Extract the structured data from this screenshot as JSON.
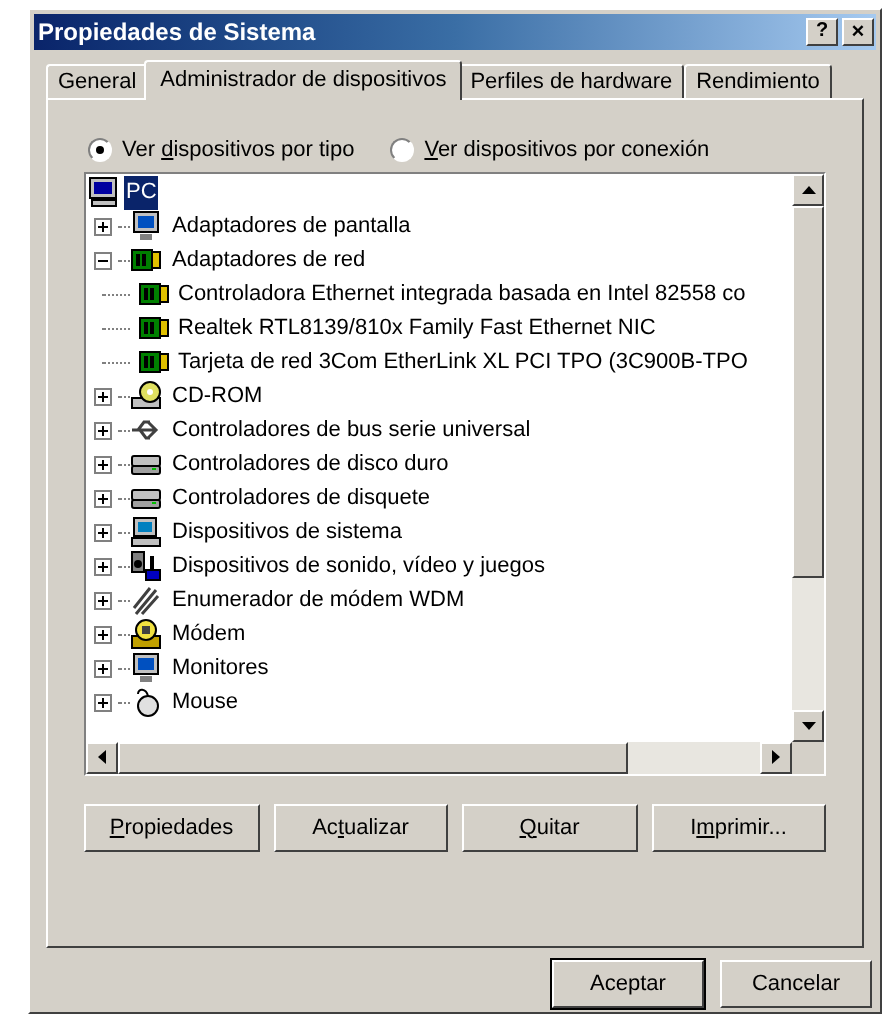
{
  "window": {
    "title": "Propiedades de Sistema",
    "help_button": "?",
    "close_button": "×"
  },
  "tabs": [
    {
      "label": "General",
      "selected": false
    },
    {
      "label": "Administrador de dispositivos",
      "selected": true
    },
    {
      "label": "Perfiles de hardware",
      "selected": false
    },
    {
      "label": "Rendimiento",
      "selected": false
    }
  ],
  "view_options": [
    {
      "label_parts": {
        "before": "Ver ",
        "key": "d",
        "after": "ispositivos por tipo"
      },
      "selected": true
    },
    {
      "label_parts": {
        "key": "V",
        "after": "er dispositivos por conexión"
      },
      "selected": false
    }
  ],
  "device_tree": {
    "label": "PC",
    "kind": "computer",
    "selected": true,
    "children": [
      {
        "label": "Adaptadores de pantalla",
        "kind": "display",
        "expanded": false
      },
      {
        "label": "Adaptadores de red",
        "kind": "network",
        "expanded": true,
        "children": [
          {
            "label": "Controladora Ethernet integrada basada en Intel 82558 co",
            "kind": "network"
          },
          {
            "label": "Realtek RTL8139/810x Family Fast Ethernet NIC",
            "kind": "network"
          },
          {
            "label": "Tarjeta de red 3Com EtherLink XL PCI TPO (3C900B-TPO",
            "kind": "network"
          }
        ]
      },
      {
        "label": "CD-ROM",
        "kind": "cdrom",
        "expanded": false
      },
      {
        "label": "Controladores de bus serie universal",
        "kind": "usb",
        "expanded": false
      },
      {
        "label": "Controladores de disco duro",
        "kind": "disk",
        "expanded": false
      },
      {
        "label": "Controladores de disquete",
        "kind": "disk",
        "expanded": false
      },
      {
        "label": "Dispositivos de sistema",
        "kind": "system",
        "expanded": false
      },
      {
        "label": "Dispositivos de sonido, vídeo y juegos",
        "kind": "sound",
        "expanded": false
      },
      {
        "label": "Enumerador de módem WDM",
        "kind": "enumerator",
        "expanded": false
      },
      {
        "label": "Módem",
        "kind": "modem",
        "expanded": false
      },
      {
        "label": "Monitores",
        "kind": "display",
        "expanded": false
      },
      {
        "label": "Mouse",
        "kind": "mouse",
        "expanded": false
      }
    ]
  },
  "device_buttons": [
    {
      "label_parts": {
        "key": "P",
        "after": "ropiedades"
      }
    },
    {
      "label_parts": {
        "before": "Ac",
        "key": "t",
        "after": "ualizar"
      }
    },
    {
      "label_parts": {
        "key": "Q",
        "after": "uitar"
      }
    },
    {
      "label_parts": {
        "before": "I",
        "key": "m",
        "after": "primir..."
      }
    }
  ],
  "dialog_buttons": [
    {
      "label": "Aceptar",
      "default": true
    },
    {
      "label": "Cancelar",
      "default": false
    }
  ]
}
